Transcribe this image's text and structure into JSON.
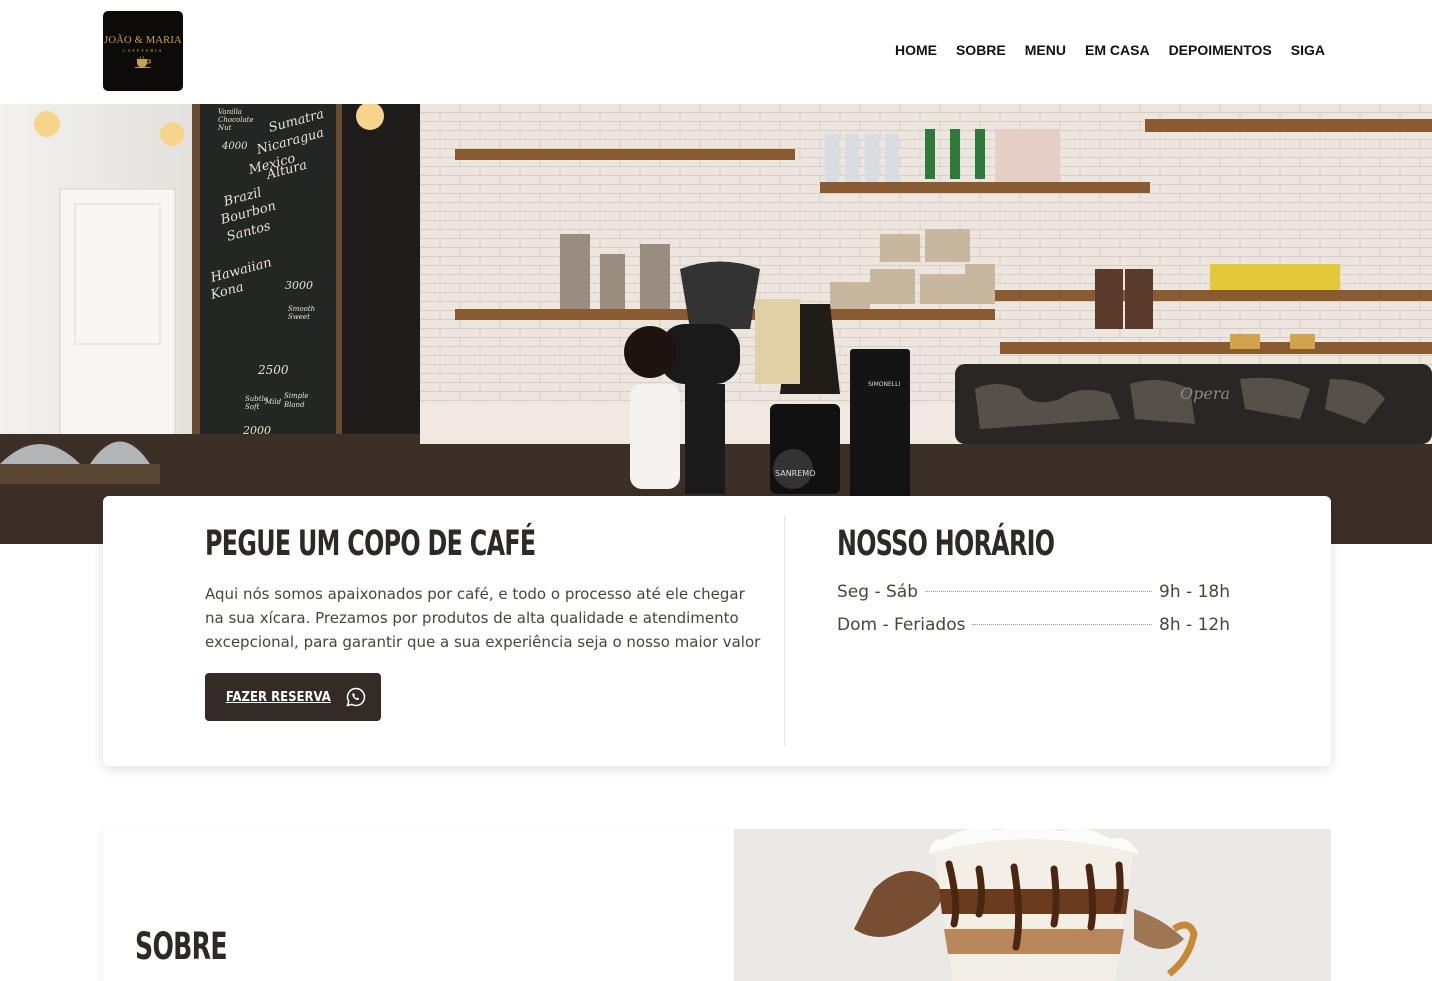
{
  "header": {
    "logo": {
      "name": "JOÃO & MARIA",
      "subtitle": "CAFETERIA"
    },
    "nav": [
      "HOME",
      "SOBRE",
      "MENU",
      "EM CASA",
      "DEPOIMENTOS",
      "SIGA"
    ]
  },
  "hero": {
    "image": "coffee-shop-bar-photo",
    "chalkboard": [
      "Vanilla",
      "Chocolate",
      "Nut",
      "4000",
      "Sumatra",
      "Nicaragua",
      "Mexico",
      "Altura",
      "Brazil",
      "Bourbon",
      "Santos",
      "Hawaiian",
      "Kona",
      "3000",
      "2500",
      "2000",
      "Subtle",
      "Soft",
      "Mild",
      "Simple",
      "Bland",
      "Smooth",
      "Sweet"
    ],
    "machine_brand": "SANREMO",
    "grinder_brand": "SIMONELLI",
    "espresso_brand": "Opera"
  },
  "intro": {
    "title": "PEGUE UM COPO DE CAFÉ",
    "text": "Aqui nós somos apaixonados por café, e todo o processo até ele chegar na sua xícara. Prezamos por produtos de alta qualidade e atendimento excepcional, para garantir que a sua experiência seja o nosso maior valor",
    "button_label": "FAZER RESERVA",
    "button_icon": "whatsapp-icon"
  },
  "hours": {
    "title": "NOSSO HORÁRIO",
    "rows": [
      {
        "days": "Seg - Sáb",
        "time": "9h - 18h"
      },
      {
        "days": "Dom - Feriados",
        "time": "8h - 12h"
      }
    ]
  },
  "about": {
    "title": "SOBRE",
    "image": "iced-coffee-splash-photo"
  },
  "colors": {
    "dark_brown": "#342b27",
    "title_text": "#2f2926",
    "body_text": "#4a4340",
    "logo_gold": "#c9a24a",
    "logo_bg": "#0d0b09"
  }
}
